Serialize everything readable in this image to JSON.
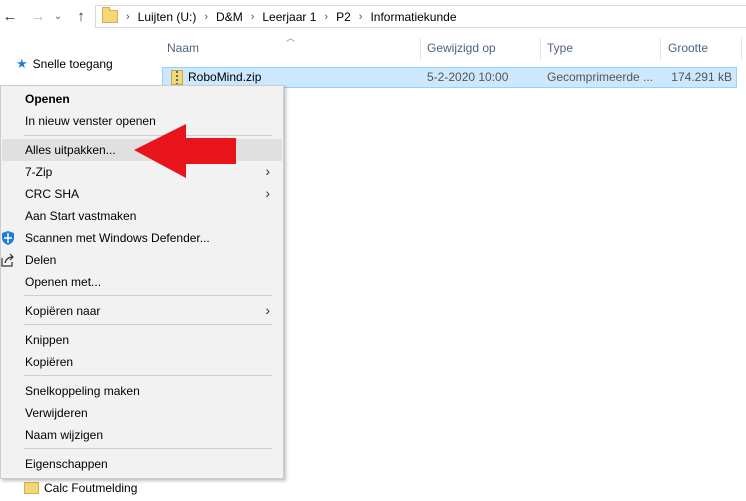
{
  "addressBar": {
    "crumbs": [
      "Luijten (U:)",
      "D&M",
      "Leerjaar 1",
      "P2",
      "Informatiekunde"
    ]
  },
  "navPane": {
    "quickAccess": "Snelle toegang",
    "calcItem": "Calc Foutmelding"
  },
  "columns": {
    "name": "Naam",
    "modified": "Gewijzigd op",
    "type": "Type",
    "size": "Grootte"
  },
  "file": {
    "name": "RoboMind.zip",
    "modified": "5-2-2020 10:00",
    "type": "Gecomprimeerde ...",
    "size": "174.291 kB"
  },
  "contextMenu": {
    "open": "Openen",
    "openNewWindow": "In nieuw venster openen",
    "extractAll": "Alles uitpakken...",
    "sevenZip": "7-Zip",
    "crcSha": "CRC SHA",
    "pinStart": "Aan Start vastmaken",
    "scanDefender": "Scannen met Windows Defender...",
    "share": "Delen",
    "openWith": "Openen met...",
    "copyTo": "Kopiëren naar",
    "cut": "Knippen",
    "copy": "Kopiëren",
    "createShortcut": "Snelkoppeling maken",
    "delete": "Verwijderen",
    "rename": "Naam wijzigen",
    "properties": "Eigenschappen"
  },
  "colors": {
    "selection": "#cce8ff",
    "highlight": "#e0e0e0",
    "arrow": "#e8141c",
    "accent": "#1e7fd8"
  }
}
